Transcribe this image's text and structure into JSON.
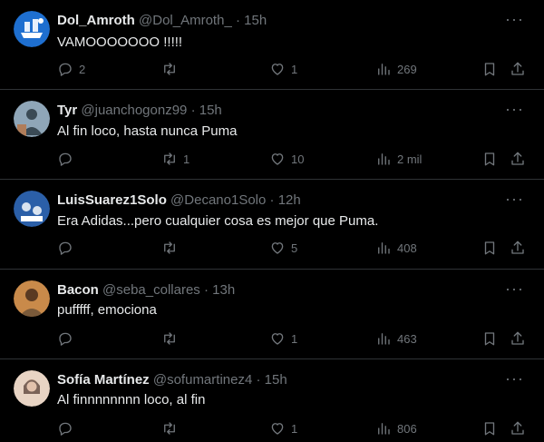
{
  "tweets": [
    {
      "name": "Dol_Amroth",
      "handle": "@Dol_Amroth_",
      "sep": "·",
      "time": "15h",
      "text": "VAMOOOOOOO !!!!!",
      "replies": "2",
      "retweets": "",
      "likes": "1",
      "views": "269",
      "avatar_colors": [
        "#1e6fd0",
        "#ffffff"
      ]
    },
    {
      "name": "Tyr",
      "handle": "@juanchogonz99",
      "sep": "·",
      "time": "15h",
      "text": "Al fin loco, hasta nunca Puma",
      "replies": "",
      "retweets": "1",
      "likes": "10",
      "views": "2 mil",
      "avatar_colors": [
        "#8fa6b8",
        "#3a4a55"
      ]
    },
    {
      "name": "LuisSuarez1Solo",
      "handle": "@Decano1Solo",
      "sep": "·",
      "time": "12h",
      "text": "Era Adidas...pero cualquier cosa es mejor que Puma.",
      "replies": "",
      "retweets": "",
      "likes": "5",
      "views": "408",
      "avatar_colors": [
        "#2b5fa8",
        "#d9e3ef"
      ]
    },
    {
      "name": "Bacon",
      "handle": "@seba_collares",
      "sep": "·",
      "time": "13h",
      "text": "pufffff, emociona",
      "replies": "",
      "retweets": "",
      "likes": "1",
      "views": "463",
      "avatar_colors": [
        "#c98a4a",
        "#5a3a22"
      ]
    },
    {
      "name": "Sofía Martínez",
      "handle": "@sofumartinez4",
      "sep": "·",
      "time": "15h",
      "text": "Al finnnnnnnn loco, al fin",
      "replies": "",
      "retweets": "",
      "likes": "1",
      "views": "806",
      "avatar_colors": [
        "#e8d4c4",
        "#7a6358"
      ]
    }
  ],
  "icons": {
    "reply": "reply-icon",
    "retweet": "retweet-icon",
    "like": "heart-icon",
    "views": "views-icon",
    "bookmark": "bookmark-icon",
    "share": "share-icon",
    "more": "more-icon"
  }
}
